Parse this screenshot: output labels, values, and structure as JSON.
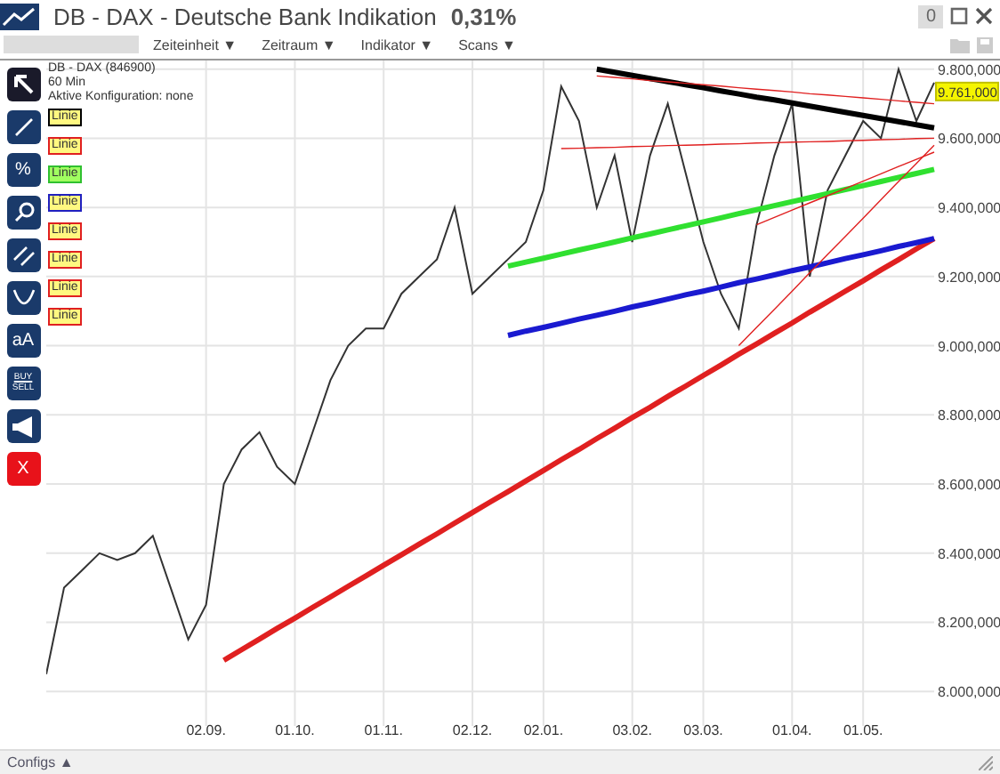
{
  "window": {
    "title": "DB - DAX - Deutsche Bank Indikation",
    "change": "0,31%",
    "count": "0"
  },
  "toolbar": {
    "menus": [
      "Zeiteinheit ▼",
      "Zeitraum ▼",
      "Indikator ▼",
      "Scans ▼"
    ]
  },
  "tools": [
    {
      "kind": "icon",
      "selected": true
    },
    {
      "kind": "icon",
      "selected": false
    },
    {
      "kind": "text",
      "selected": false,
      "label": "%"
    },
    {
      "kind": "icon",
      "selected": false
    },
    {
      "kind": "icon",
      "selected": false
    },
    {
      "kind": "icon",
      "selected": false
    },
    {
      "kind": "text",
      "selected": false,
      "label": "aA"
    },
    {
      "kind": "stack",
      "selected": false,
      "label": "BUY",
      "sublabel": "SELL"
    },
    {
      "kind": "icon",
      "selected": false
    },
    {
      "kind": "delete",
      "selected": false,
      "label": "X"
    }
  ],
  "chart": {
    "name": "DB - DAX (846900)",
    "interval": "60 Min",
    "config": "Aktive Konfiguration: none",
    "last_price": "9.761,000",
    "legend": [
      {
        "label": "Linie",
        "color": "#000000"
      },
      {
        "label": "Linie",
        "color": "#e02020"
      },
      {
        "label": "Linie",
        "color": "#30c030"
      },
      {
        "label": "Linie",
        "color": "#2020c0"
      },
      {
        "label": "Linie",
        "color": "#e02020"
      },
      {
        "label": "Linie",
        "color": "#e02020"
      },
      {
        "label": "Linie",
        "color": "#e02020"
      },
      {
        "label": "Linie",
        "color": "#e02020"
      }
    ],
    "chart_data": {
      "type": "line",
      "grid": true,
      "ylim": [
        7900,
        9825
      ],
      "categories": [
        null,
        null,
        null,
        null,
        null,
        null,
        null,
        null,
        null,
        "02.09.",
        null,
        null,
        null,
        null,
        "01.10.",
        null,
        null,
        null,
        null,
        "01.11.",
        null,
        null,
        null,
        null,
        "02.12.",
        null,
        null,
        null,
        "02.01.",
        null,
        null,
        null,
        null,
        "03.02.",
        null,
        null,
        null,
        "03.03.",
        null,
        null,
        null,
        null,
        "01.04.",
        null,
        null,
        null,
        "01.05.",
        null,
        null,
        null,
        null
      ],
      "yticks": [
        {
          "value": 8000,
          "label": "8.000,000"
        },
        {
          "value": 8200,
          "label": "8.200,000"
        },
        {
          "value": 8400,
          "label": "8.400,000"
        },
        {
          "value": 8600,
          "label": "8.600,000"
        },
        {
          "value": 8800,
          "label": "8.800,000"
        },
        {
          "value": 9000,
          "label": "9.000,000"
        },
        {
          "value": 9200,
          "label": "9.200,000"
        },
        {
          "value": 9400,
          "label": "9.400,000"
        },
        {
          "value": 9600,
          "label": "9.600,000"
        },
        {
          "value": 9800,
          "label": "9.800,000"
        }
      ],
      "series": [
        {
          "color": "#333333",
          "values": [
            8050,
            8300,
            8350,
            8400,
            8380,
            8400,
            8450,
            8300,
            8150,
            8250,
            8600,
            8700,
            8750,
            8650,
            8600,
            8750,
            8900,
            9000,
            9050,
            9050,
            9150,
            9200,
            9250,
            9400,
            9150,
            9200,
            9250,
            9300,
            9450,
            9750,
            9650,
            9400,
            9550,
            9300,
            9550,
            9700,
            9500,
            9300,
            9150,
            9050,
            9350,
            9550,
            9700,
            9200,
            9450,
            9550,
            9650,
            9600,
            9800,
            9650,
            9761
          ]
        },
        {
          "color": "#000000",
          "values": [
            null,
            null,
            null,
            null,
            null,
            null,
            null,
            null,
            null,
            null,
            null,
            null,
            null,
            null,
            null,
            null,
            null,
            null,
            null,
            null,
            null,
            null,
            null,
            null,
            null,
            null,
            null,
            null,
            null,
            null,
            null,
            9800,
            9791,
            9782,
            9773,
            9764,
            9755,
            9746,
            9737,
            9728,
            9719,
            9711,
            9702,
            9693,
            9684,
            9675,
            9666,
            9657,
            9648,
            9639,
            9630
          ]
        },
        {
          "color": "#e02020",
          "values": [
            null,
            null,
            null,
            null,
            null,
            null,
            null,
            null,
            null,
            null,
            8090,
            8121,
            8151,
            8182,
            8212,
            8243,
            8273,
            8304,
            8334,
            8365,
            8395,
            8426,
            8456,
            8487,
            8517,
            8548,
            8578,
            8609,
            8639,
            8670,
            8700,
            8731,
            8761,
            8792,
            8822,
            8853,
            8883,
            8914,
            8944,
            8975,
            9005,
            9036,
            9066,
            9097,
            9127,
            9158,
            9188,
            9219,
            9249,
            9280,
            9310
          ]
        },
        {
          "color": "#30e030",
          "values": [
            null,
            null,
            null,
            null,
            null,
            null,
            null,
            null,
            null,
            null,
            null,
            null,
            null,
            null,
            null,
            null,
            null,
            null,
            null,
            null,
            null,
            null,
            null,
            null,
            null,
            null,
            9230,
            9242,
            9253,
            9265,
            9277,
            9288,
            9300,
            9312,
            9323,
            9335,
            9347,
            9358,
            9370,
            9382,
            9393,
            9405,
            9417,
            9428,
            9440,
            9452,
            9463,
            9475,
            9487,
            9498,
            9510
          ]
        },
        {
          "color": "#1a1ad0",
          "values": [
            null,
            null,
            null,
            null,
            null,
            null,
            null,
            null,
            null,
            null,
            null,
            null,
            null,
            null,
            null,
            null,
            null,
            null,
            null,
            null,
            null,
            null,
            null,
            null,
            null,
            null,
            9030,
            9042,
            9053,
            9065,
            9077,
            9088,
            9100,
            9112,
            9123,
            9135,
            9147,
            9158,
            9170,
            9182,
            9193,
            9205,
            9217,
            9228,
            9240,
            9252,
            9263,
            9275,
            9287,
            9298,
            9310
          ]
        },
        {
          "color": "#e02020",
          "values": [
            null,
            null,
            null,
            null,
            null,
            null,
            null,
            null,
            null,
            null,
            null,
            null,
            null,
            null,
            null,
            null,
            null,
            null,
            null,
            null,
            null,
            null,
            null,
            null,
            null,
            null,
            null,
            null,
            null,
            9570,
            9571,
            9573,
            9574,
            9576,
            9577,
            9579,
            9580,
            9581,
            9583,
            9584,
            9586,
            9587,
            9589,
            9590,
            9591,
            9593,
            9594,
            9596,
            9597,
            9599,
            9600
          ]
        },
        {
          "color": "#e02020",
          "values": [
            null,
            null,
            null,
            null,
            null,
            null,
            null,
            null,
            null,
            null,
            null,
            null,
            null,
            null,
            null,
            null,
            null,
            null,
            null,
            null,
            null,
            null,
            null,
            null,
            null,
            null,
            null,
            null,
            null,
            null,
            null,
            9780,
            9776,
            9772,
            9767,
            9763,
            9759,
            9755,
            9751,
            9746,
            9742,
            9738,
            9734,
            9729,
            9725,
            9721,
            9717,
            9713,
            9708,
            9704,
            9700
          ]
        },
        {
          "color": "#e02020",
          "values": [
            null,
            null,
            null,
            null,
            null,
            null,
            null,
            null,
            null,
            null,
            null,
            null,
            null,
            null,
            null,
            null,
            null,
            null,
            null,
            null,
            null,
            null,
            null,
            null,
            null,
            null,
            null,
            null,
            null,
            null,
            null,
            null,
            null,
            null,
            null,
            null,
            null,
            null,
            null,
            9000,
            9053,
            9105,
            9158,
            9211,
            9264,
            9316,
            9369,
            9422,
            9475,
            9527,
            9580
          ]
        },
        {
          "color": "#e02020",
          "values": [
            null,
            null,
            null,
            null,
            null,
            null,
            null,
            null,
            null,
            null,
            null,
            null,
            null,
            null,
            null,
            null,
            null,
            null,
            null,
            null,
            null,
            null,
            null,
            null,
            null,
            null,
            null,
            null,
            null,
            null,
            null,
            null,
            null,
            null,
            null,
            null,
            null,
            null,
            null,
            null,
            9350,
            9371,
            9392,
            9413,
            9434,
            9455,
            9476,
            9497,
            9518,
            9539,
            9560
          ]
        }
      ]
    }
  },
  "footer": {
    "label": "Configs ▲"
  }
}
